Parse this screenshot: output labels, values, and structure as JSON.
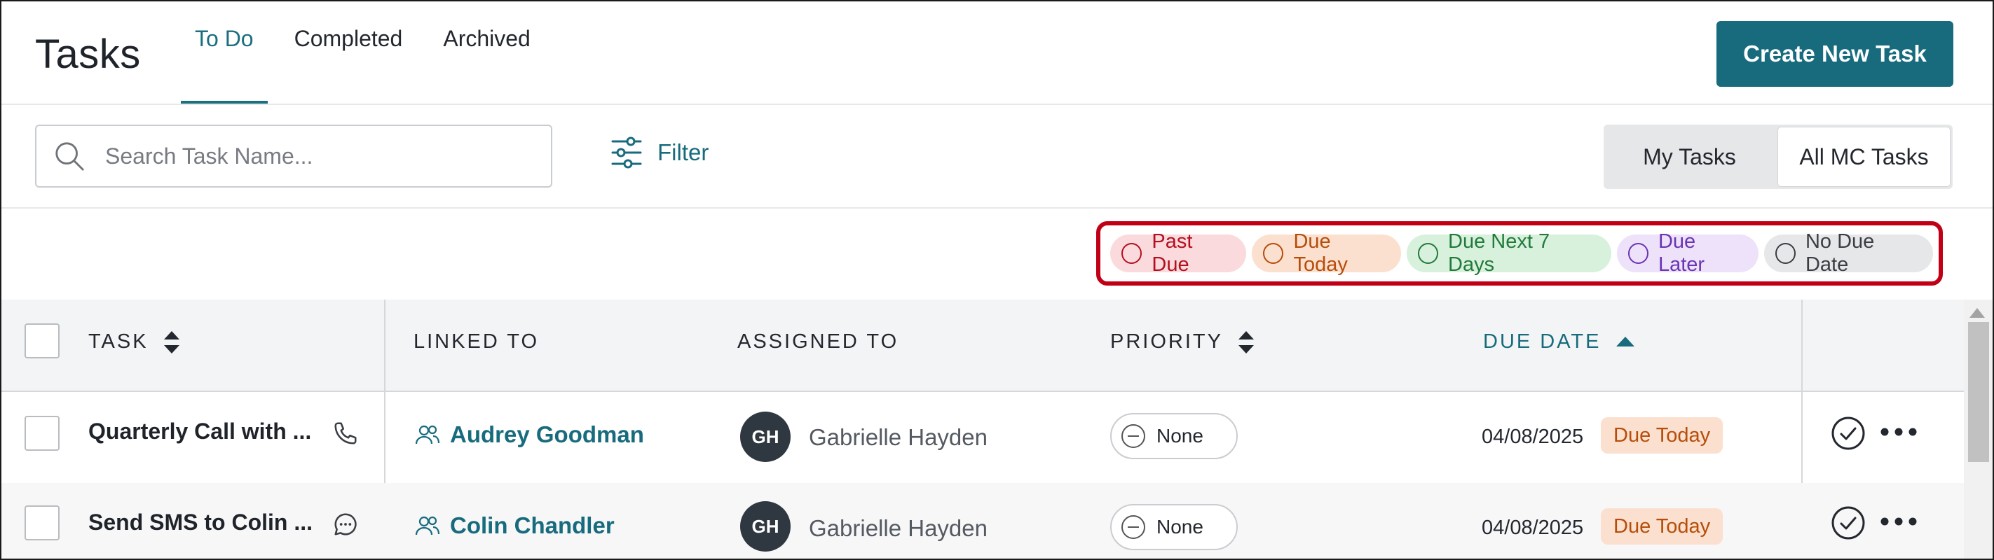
{
  "header": {
    "title": "Tasks",
    "tabs": [
      {
        "label": "To Do",
        "active": true
      },
      {
        "label": "Completed"
      },
      {
        "label": "Archived"
      }
    ],
    "create_button": "Create New Task"
  },
  "toolbar": {
    "search_placeholder": "Search Task Name...",
    "filter_label": "Filter",
    "segment": [
      "My Tasks",
      "All MC Tasks"
    ],
    "segment_selected": "All MC Tasks"
  },
  "legend": [
    {
      "label": "Past Due",
      "color": "#b3101f",
      "bg": "#fbdadd"
    },
    {
      "label": "Due Today",
      "color": "#b64d0a",
      "bg": "#fbe0cf"
    },
    {
      "label": "Due Next 7 Days",
      "color": "#227a3b",
      "bg": "#d8f1dd"
    },
    {
      "label": "Due Later",
      "color": "#6b35b3",
      "bg": "#ede2fa"
    },
    {
      "label": "No Due Date",
      "color": "#3a3e44",
      "bg": "#e6e7e9"
    }
  ],
  "columns": {
    "task": "TASK",
    "linked_to": "LINKED TO",
    "assigned_to": "ASSIGNED TO",
    "priority": "PRIORITY",
    "due_date": "DUE DATE"
  },
  "rows": [
    {
      "task": "Quarterly Call with ...",
      "task_icon": "phone-icon",
      "linked_to": "Audrey Goodman",
      "avatar": "GH",
      "assigned_to": "Gabrielle Hayden",
      "priority": "None",
      "due_date": "04/08/2025",
      "due_status": "Due Today"
    },
    {
      "task": "Send SMS to Colin ...",
      "task_icon": "chat-bubble-icon",
      "linked_to": "Colin Chandler",
      "avatar": "GH",
      "assigned_to": "Gabrielle Hayden",
      "priority": "None",
      "due_date": "04/08/2025",
      "due_status": "Due Today"
    }
  ],
  "colors": {
    "accent": "#176b7d",
    "highlight_border": "#c20015"
  }
}
